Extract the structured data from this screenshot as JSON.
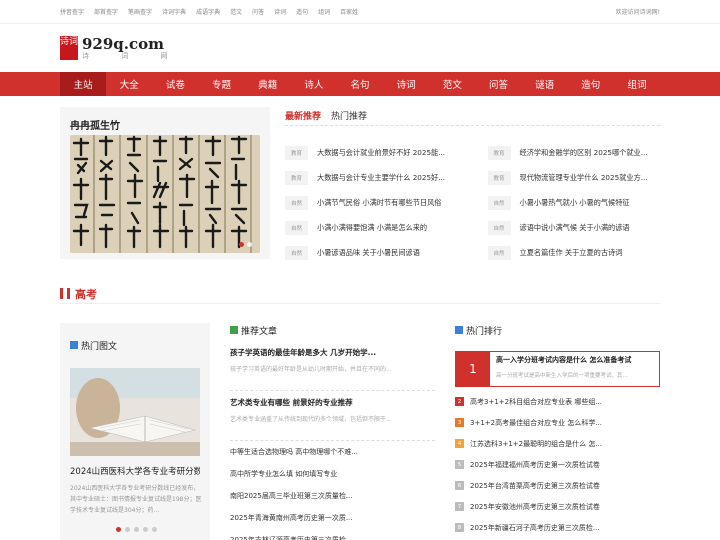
{
  "topbar": {
    "links": [
      "拼音查字",
      "部首查字",
      "笔画查字",
      "诗词字典",
      "成语字典",
      "范文",
      "问答",
      "诗词",
      "造句",
      "组词",
      "百家姓"
    ],
    "welcome": "欢迎访问诗词网!"
  },
  "logo": {
    "box": "诗词",
    "name": "929q.com",
    "sub": "诗 词 网"
  },
  "nav": [
    "主站",
    "大全",
    "试卷",
    "专题",
    "典籍",
    "诗人",
    "名句",
    "诗词",
    "范文",
    "问答",
    "谜语",
    "造句",
    "组词"
  ],
  "hero": {
    "title": "冉冉孤生竹"
  },
  "news": {
    "tabs": [
      "最新推荐",
      "热门推荐"
    ],
    "items": [
      {
        "tag": "教育",
        "text": "大数据与会计就业前景好不好 2025能..."
      },
      {
        "tag": "教育",
        "text": "经济学和金融学的区别 2025哪个就业..."
      },
      {
        "tag": "教育",
        "text": "大数据与会计专业主要学什么 2025好..."
      },
      {
        "tag": "教育",
        "text": "现代物流管理专业学什么 2025就业方..."
      },
      {
        "tag": "自然",
        "text": "小满节气民俗 小满时节有哪些节日风俗"
      },
      {
        "tag": "自然",
        "text": "小暑小暑热气就小 小暑的气候特征"
      },
      {
        "tag": "自然",
        "text": "小满小满得要饱满 小满是怎么来的"
      },
      {
        "tag": "自然",
        "text": "谚语中说小满气候 关于小满的谚语"
      },
      {
        "tag": "自然",
        "text": "小暑谚语品味 关于小暑民间谚语"
      },
      {
        "tag": "自然",
        "text": "立夏名篇佳作 关于立夏的古诗词"
      }
    ]
  },
  "section": {
    "title": "高考"
  },
  "col1": {
    "head": "热门图文",
    "title": "2024山西医科大学各专业考研分数线...",
    "desc": "2024山西医科大学各专业考研分数线已经发布，其中专业硕士：图书情报专业复试线是198分；医学技术专业复试线是304分；药..."
  },
  "col2": {
    "head": "推荐文章",
    "featured": [
      {
        "title": "孩子学英语的最佳年龄是多大 几岁开始学...",
        "desc": "孩子学习英语的最好年龄是从幼儿时期开始，并且在不同的..."
      },
      {
        "title": "艺术类专业有哪些 前景好的专业推荐",
        "desc": "艺术类专业涵盖了从传统到现代的多个领域，包括但不限于..."
      }
    ],
    "items": [
      "中等生适合选物理吗 高中物理哪个不难...",
      "高中所学专业怎么填 如何填写专业",
      "南阳2025届高三毕业班第三次质量检...",
      "2025年青海黄南州高考历史第一次质...",
      "2025年吉林辽源高考历史第三次质检..."
    ]
  },
  "col3": {
    "head": "热门排行",
    "top": {
      "num": "1",
      "title": "高一入学分班考试内容是什么 怎么准备考试",
      "desc": "高一分班考试是高中新生入学后的一项重要考试，其..."
    },
    "items": [
      {
        "num": "2",
        "text": "高考3+1+2科目组合对应专业表 哪些组..."
      },
      {
        "num": "3",
        "text": "3+1+2高考最佳组合对应专业 怎么科学..."
      },
      {
        "num": "4",
        "text": "江苏选科3+1+2最聪明的组合是什么 怎..."
      },
      {
        "num": "5",
        "text": "2025年福建福州高考历史第一次质检试卷"
      },
      {
        "num": "6",
        "text": "2025年台湾苗栗高考历史第三次质检试卷"
      },
      {
        "num": "7",
        "text": "2025年安徽池州高考历史第三次质检试卷"
      },
      {
        "num": "8",
        "text": "2025年新疆石河子高考历史第三次质检..."
      }
    ]
  },
  "colors": {
    "brand": "#d0312d",
    "rank_hot": [
      "#d0312d",
      "#e8772e",
      "#f2a33b"
    ],
    "rank_normal": "#bbbbbb"
  }
}
